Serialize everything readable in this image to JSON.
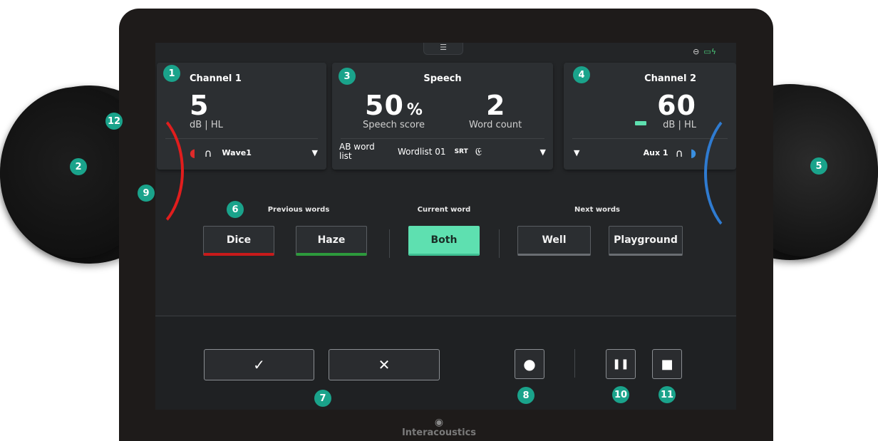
{
  "status": {
    "link_icon": "link-icon",
    "battery_icon": "battery-charging-icon"
  },
  "menu": {
    "icon": "☰"
  },
  "channel1": {
    "title": "Channel 1",
    "value": "5",
    "unit": "dB | HL",
    "stimulus": "Wave1"
  },
  "speech": {
    "title": "Speech",
    "score": "50",
    "score_unit": "%",
    "score_label": "Speech score",
    "count": "2",
    "count_label": "Word count",
    "list": "AB word list",
    "wordlist": "Wordlist 01",
    "test": "SRT"
  },
  "channel2": {
    "title": "Channel 2",
    "value": "60",
    "unit": "dB | HL",
    "source": "Aux 1"
  },
  "words": {
    "previous_label": "Previous words",
    "current_label": "Current word",
    "next_label": "Next words",
    "previous": [
      "Dice",
      "Haze"
    ],
    "current": "Both",
    "next": [
      "Well",
      "Playground"
    ]
  },
  "controls": {
    "accept": "✓",
    "reject": "✕",
    "record": "●",
    "pause": "❚❚",
    "stop": "■"
  },
  "brand": "Interacoustics",
  "badges": [
    "1",
    "2",
    "3",
    "4",
    "5",
    "6",
    "7",
    "8",
    "9",
    "10",
    "11",
    "12"
  ],
  "colors": {
    "accent": "#5ee0b0",
    "left_ear": "#e11d1d",
    "right_ear": "#2f7bd0",
    "badge": "#1aa38b"
  }
}
